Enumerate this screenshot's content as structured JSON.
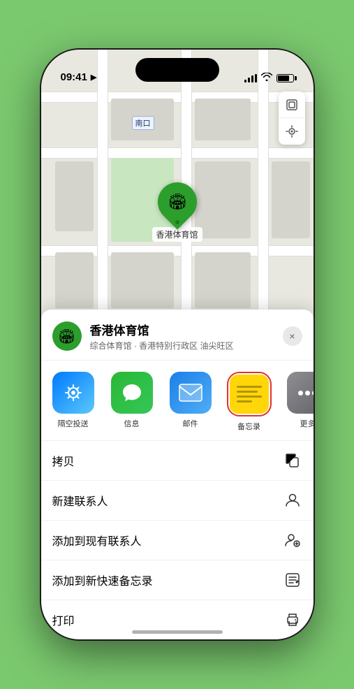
{
  "statusBar": {
    "time": "09:41",
    "locationArrow": "▶"
  },
  "map": {
    "label": "南口",
    "controls": [
      "map-layers",
      "location"
    ]
  },
  "pin": {
    "label": "香港体育馆",
    "icon": "🏟"
  },
  "venueHeader": {
    "name": "香港体育馆",
    "desc": "综合体育馆 · 香港特别行政区 油尖旺区",
    "closeLabel": "×"
  },
  "shareItems": [
    {
      "id": "airdrop",
      "label": "隔空投送",
      "type": "airdrop"
    },
    {
      "id": "messages",
      "label": "信息",
      "type": "messages"
    },
    {
      "id": "mail",
      "label": "邮件",
      "type": "mail"
    },
    {
      "id": "notes",
      "label": "备忘录",
      "type": "notes",
      "selected": true
    },
    {
      "id": "more",
      "label": "更多",
      "type": "more"
    }
  ],
  "actionItems": [
    {
      "id": "copy",
      "label": "拷贝",
      "icon": "copy"
    },
    {
      "id": "new-contact",
      "label": "新建联系人",
      "icon": "person-plus"
    },
    {
      "id": "add-contact",
      "label": "添加到现有联系人",
      "icon": "person-add"
    },
    {
      "id": "add-note",
      "label": "添加到新快速备忘录",
      "icon": "note"
    },
    {
      "id": "print",
      "label": "打印",
      "icon": "print"
    }
  ]
}
